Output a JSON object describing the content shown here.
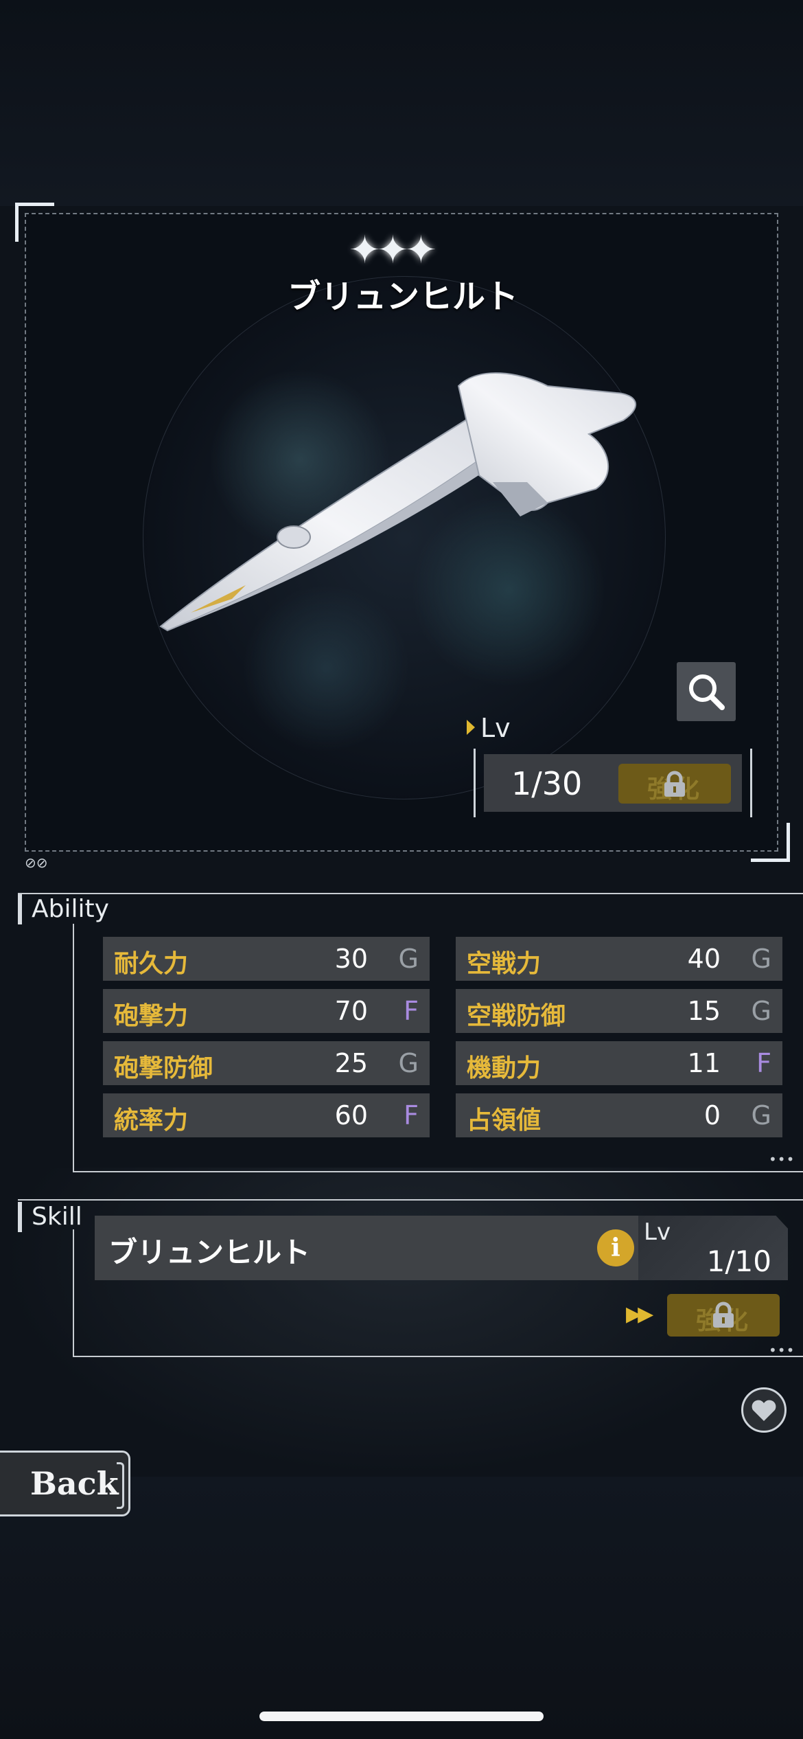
{
  "viewer": {
    "stars": "✦✦✦",
    "ship_name": "ブリュンヒルト",
    "lv_label": "Lv",
    "lv_value": "1/30",
    "enhance_label": "強化",
    "enhance_locked": true,
    "small_icons": "⊘⊘"
  },
  "ability": {
    "tab_label": "Ability",
    "stats": [
      {
        "name": "耐久力",
        "value": "30",
        "rank": "G"
      },
      {
        "name": "空戦力",
        "value": "40",
        "rank": "G"
      },
      {
        "name": "砲撃力",
        "value": "70",
        "rank": "F"
      },
      {
        "name": "空戦防御",
        "value": "15",
        "rank": "G"
      },
      {
        "name": "砲撃防御",
        "value": "25",
        "rank": "G"
      },
      {
        "name": "機動力",
        "value": "11",
        "rank": "F"
      },
      {
        "name": "統率力",
        "value": "60",
        "rank": "F"
      },
      {
        "name": "占領値",
        "value": "0",
        "rank": "G"
      }
    ],
    "more": "•••"
  },
  "skill": {
    "tab_label": "Skill",
    "name": "ブリュンヒルト",
    "info_icon": "i",
    "lv_label": "Lv",
    "lv_value": "1/10",
    "enhance_label": "強化",
    "enhance_locked": true,
    "more": "•••"
  },
  "nav": {
    "back_label": "Back"
  },
  "colors": {
    "accent_gold": "#e6b93a",
    "rank_G": "#9aa0a6",
    "rank_F": "#a98be0",
    "panel": "#3f4246"
  }
}
